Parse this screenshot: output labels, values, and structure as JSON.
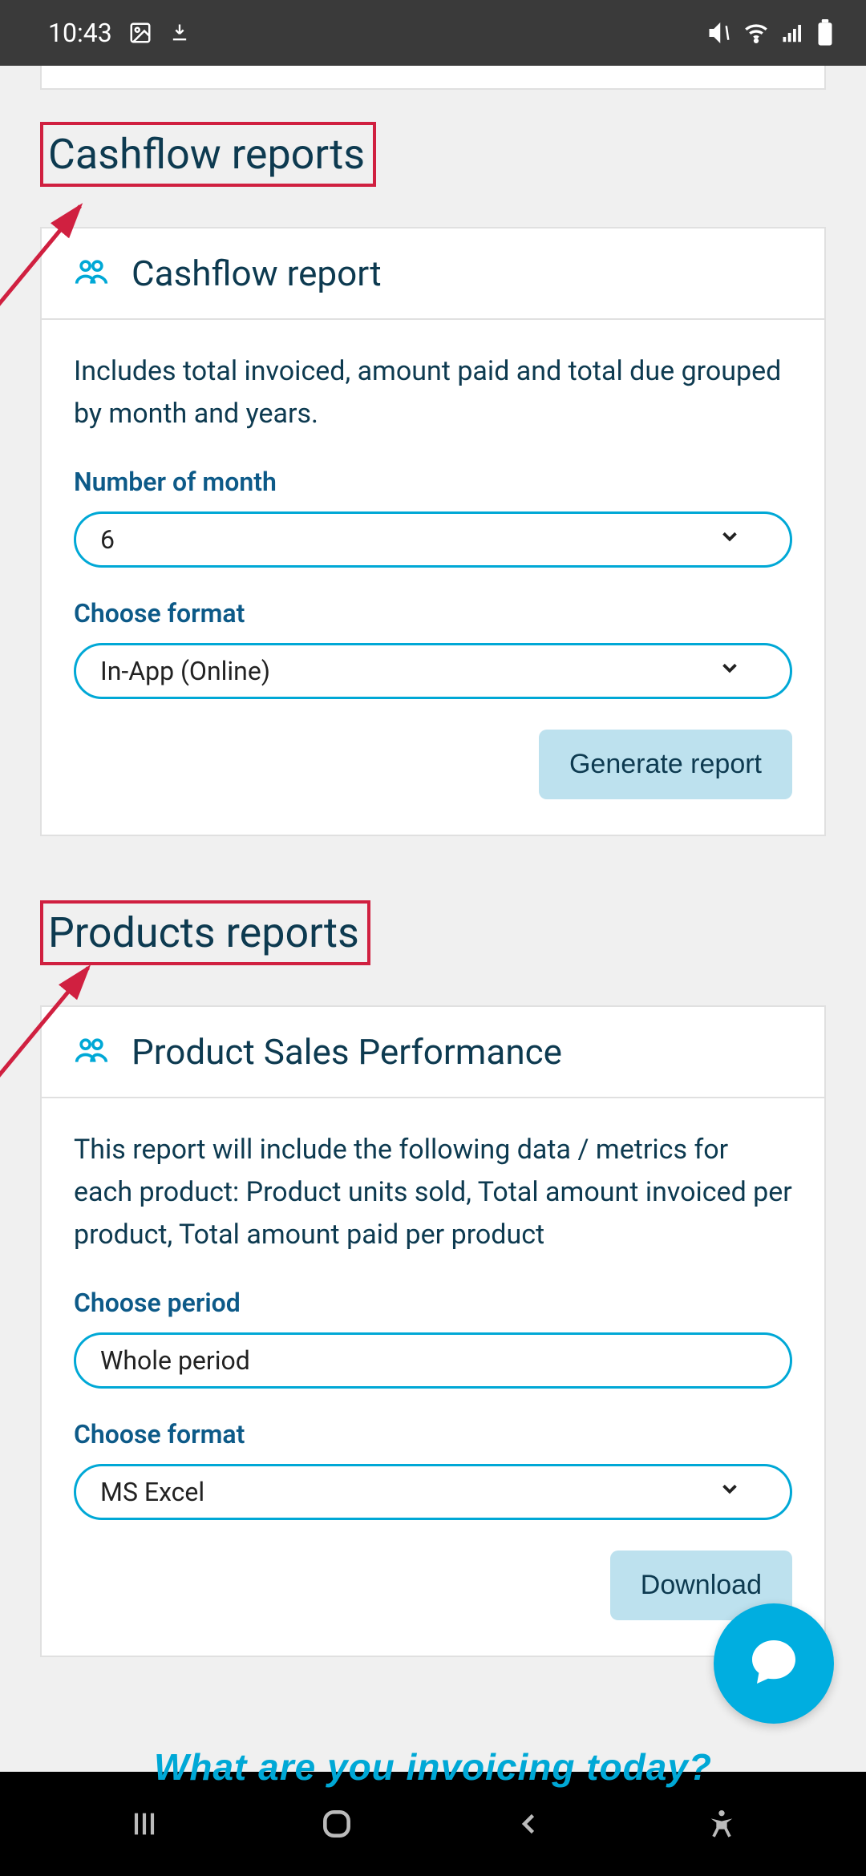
{
  "statusbar": {
    "time": "10:43"
  },
  "sections": {
    "cashflow": {
      "heading": "Cashflow reports",
      "card_title": "Cashflow report",
      "description": "Includes total invoiced, amount paid and total due grouped by month and years.",
      "field_month_label": "Number of month",
      "field_month_value": "6",
      "field_format_label": "Choose format",
      "field_format_value": "In-App (Online)",
      "action": "Generate report"
    },
    "products": {
      "heading": "Products reports",
      "card_title": "Product Sales Performance",
      "description": "This report will include the following data / metrics for each product: Product units sold, Total amount invoiced per product, Total amount paid per product",
      "field_period_label": "Choose period",
      "field_period_value": "Whole period",
      "field_format_label": "Choose format",
      "field_format_value": "MS Excel",
      "action": "Download"
    }
  },
  "footer_teaser": "What are you invoicing today?"
}
